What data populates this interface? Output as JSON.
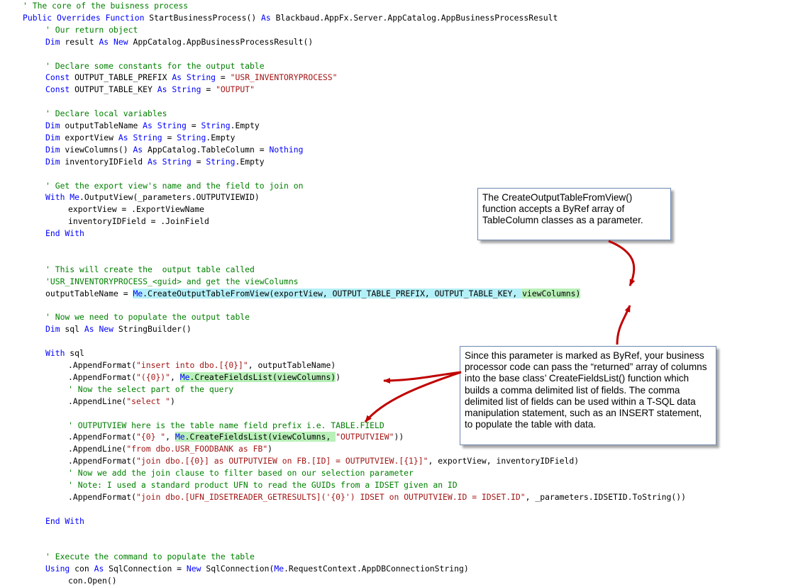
{
  "code_lines": [
    {
      "indent": 1,
      "segments": [
        {
          "t": "' The core of the buisness process",
          "c": "cmt"
        }
      ]
    },
    {
      "indent": 1,
      "segments": [
        {
          "t": "Public Overrides Function",
          "c": "kw"
        },
        {
          "t": " StartBusinessProcess() ",
          "c": "txt"
        },
        {
          "t": "As",
          "c": "kw"
        },
        {
          "t": " Blackbaud.AppFx.Server.AppCatalog.AppBusinessProcessResult",
          "c": "txt"
        }
      ]
    },
    {
      "indent": 2,
      "segments": [
        {
          "t": "' Our return object",
          "c": "cmt"
        }
      ]
    },
    {
      "indent": 2,
      "segments": [
        {
          "t": "Dim",
          "c": "kw"
        },
        {
          "t": " result ",
          "c": "txt"
        },
        {
          "t": "As New",
          "c": "kw"
        },
        {
          "t": " AppCatalog.AppBusinessProcessResult()",
          "c": "txt"
        }
      ]
    },
    {
      "indent": 0,
      "segments": []
    },
    {
      "indent": 2,
      "segments": [
        {
          "t": "' Declare some constants for the output table",
          "c": "cmt"
        }
      ]
    },
    {
      "indent": 2,
      "segments": [
        {
          "t": "Const",
          "c": "kw"
        },
        {
          "t": " OUTPUT_TABLE_PREFIX ",
          "c": "txt"
        },
        {
          "t": "As String",
          "c": "kw"
        },
        {
          "t": " = ",
          "c": "txt"
        },
        {
          "t": "\"USR_INVENTORYPROCESS\"",
          "c": "str"
        }
      ]
    },
    {
      "indent": 2,
      "segments": [
        {
          "t": "Const",
          "c": "kw"
        },
        {
          "t": " OUTPUT_TABLE_KEY ",
          "c": "txt"
        },
        {
          "t": "As String",
          "c": "kw"
        },
        {
          "t": " = ",
          "c": "txt"
        },
        {
          "t": "\"OUTPUT\"",
          "c": "str"
        }
      ]
    },
    {
      "indent": 0,
      "segments": []
    },
    {
      "indent": 2,
      "segments": [
        {
          "t": "' Declare local variables",
          "c": "cmt"
        }
      ]
    },
    {
      "indent": 2,
      "segments": [
        {
          "t": "Dim",
          "c": "kw"
        },
        {
          "t": " outputTableName ",
          "c": "txt"
        },
        {
          "t": "As String",
          "c": "kw"
        },
        {
          "t": " = ",
          "c": "txt"
        },
        {
          "t": "String",
          "c": "kw"
        },
        {
          "t": ".Empty",
          "c": "txt"
        }
      ]
    },
    {
      "indent": 2,
      "segments": [
        {
          "t": "Dim",
          "c": "kw"
        },
        {
          "t": " exportView ",
          "c": "txt"
        },
        {
          "t": "As String",
          "c": "kw"
        },
        {
          "t": " = ",
          "c": "txt"
        },
        {
          "t": "String",
          "c": "kw"
        },
        {
          "t": ".Empty",
          "c": "txt"
        }
      ]
    },
    {
      "indent": 2,
      "segments": [
        {
          "t": "Dim",
          "c": "kw"
        },
        {
          "t": " viewColumns() ",
          "c": "txt"
        },
        {
          "t": "As",
          "c": "kw"
        },
        {
          "t": " AppCatalog.TableColumn = ",
          "c": "txt"
        },
        {
          "t": "Nothing",
          "c": "kw"
        }
      ]
    },
    {
      "indent": 2,
      "segments": [
        {
          "t": "Dim",
          "c": "kw"
        },
        {
          "t": " inventoryIDField ",
          "c": "txt"
        },
        {
          "t": "As String",
          "c": "kw"
        },
        {
          "t": " = ",
          "c": "txt"
        },
        {
          "t": "String",
          "c": "kw"
        },
        {
          "t": ".Empty",
          "c": "txt"
        }
      ]
    },
    {
      "indent": 0,
      "segments": []
    },
    {
      "indent": 2,
      "segments": [
        {
          "t": "' Get the export view's name and the field to join on",
          "c": "cmt"
        }
      ]
    },
    {
      "indent": 2,
      "segments": [
        {
          "t": "With Me",
          "c": "kw"
        },
        {
          "t": ".OutputView(_parameters.OUTPUTVIEWID)",
          "c": "txt"
        }
      ]
    },
    {
      "indent": 3,
      "segments": [
        {
          "t": "exportView = .ExportViewName",
          "c": "txt"
        }
      ]
    },
    {
      "indent": 3,
      "segments": [
        {
          "t": "inventoryIDField = .JoinField",
          "c": "txt"
        }
      ]
    },
    {
      "indent": 2,
      "segments": [
        {
          "t": "End With",
          "c": "kw"
        }
      ]
    },
    {
      "indent": 0,
      "segments": []
    },
    {
      "indent": 0,
      "segments": []
    },
    {
      "indent": 2,
      "segments": [
        {
          "t": "' This will create the  output table called",
          "c": "cmt"
        }
      ]
    },
    {
      "indent": 2,
      "segments": [
        {
          "t": "'USR_INVENTORYPROCESS_<guid> and get the viewColumns",
          "c": "cmt"
        }
      ]
    },
    {
      "indent": 2,
      "segments": [
        {
          "t": "outputTableName = ",
          "c": "txt"
        },
        {
          "t": "Me",
          "c": "kw",
          "h": "blue"
        },
        {
          "t": ".CreateOutputTableFromView(exportView, OUTPUT_TABLE_PREFIX, OUTPUT_TABLE_KEY, ",
          "c": "txt",
          "h": "blue"
        },
        {
          "t": "viewColumns)",
          "c": "txt",
          "h": "green"
        }
      ]
    },
    {
      "indent": 0,
      "segments": []
    },
    {
      "indent": 2,
      "segments": [
        {
          "t": "' Now we need to populate the output table",
          "c": "cmt"
        }
      ]
    },
    {
      "indent": 2,
      "segments": [
        {
          "t": "Dim",
          "c": "kw"
        },
        {
          "t": " sql ",
          "c": "txt"
        },
        {
          "t": "As New",
          "c": "kw"
        },
        {
          "t": " StringBuilder()",
          "c": "txt"
        }
      ]
    },
    {
      "indent": 0,
      "segments": []
    },
    {
      "indent": 2,
      "segments": [
        {
          "t": "With",
          "c": "kw"
        },
        {
          "t": " sql",
          "c": "txt"
        }
      ]
    },
    {
      "indent": 3,
      "segments": [
        {
          "t": ".AppendFormat(",
          "c": "txt"
        },
        {
          "t": "\"insert into dbo.[{0}]\"",
          "c": "str"
        },
        {
          "t": ", outputTableName)",
          "c": "txt"
        }
      ]
    },
    {
      "indent": 3,
      "segments": [
        {
          "t": ".AppendFormat(",
          "c": "txt"
        },
        {
          "t": "\"({0})\"",
          "c": "str"
        },
        {
          "t": ", ",
          "c": "txt"
        },
        {
          "t": "Me",
          "c": "kw",
          "h": "green"
        },
        {
          "t": ".CreateFieldsList(viewColumns)",
          "c": "txt",
          "h": "green"
        },
        {
          "t": ")",
          "c": "txt"
        }
      ]
    },
    {
      "indent": 3,
      "segments": [
        {
          "t": "' Now the select part of the query",
          "c": "cmt"
        }
      ]
    },
    {
      "indent": 3,
      "segments": [
        {
          "t": ".AppendLine(",
          "c": "txt"
        },
        {
          "t": "\"select \"",
          "c": "str"
        },
        {
          "t": ")",
          "c": "txt"
        }
      ]
    },
    {
      "indent": 0,
      "segments": []
    },
    {
      "indent": 3,
      "segments": [
        {
          "t": "' OUTPUTVIEW here is the table name field prefix i.e. TABLE.FIELD",
          "c": "cmt"
        }
      ]
    },
    {
      "indent": 3,
      "segments": [
        {
          "t": ".AppendFormat(",
          "c": "txt"
        },
        {
          "t": "\"{0} \"",
          "c": "str"
        },
        {
          "t": ", ",
          "c": "txt"
        },
        {
          "t": "Me",
          "c": "kw",
          "h": "green"
        },
        {
          "t": ".CreateFieldsList(viewColumns, ",
          "c": "txt",
          "h": "green"
        },
        {
          "t": "\"OUTPUTVIEW\"",
          "c": "str"
        },
        {
          "t": "))",
          "c": "txt"
        }
      ]
    },
    {
      "indent": 3,
      "segments": [
        {
          "t": ".AppendLine(",
          "c": "txt"
        },
        {
          "t": "\"from dbo.USR_FOODBANK as FB\"",
          "c": "str"
        },
        {
          "t": ")",
          "c": "txt"
        }
      ]
    },
    {
      "indent": 3,
      "segments": [
        {
          "t": ".AppendFormat(",
          "c": "txt"
        },
        {
          "t": "\"join dbo.[{0}] as OUTPUTVIEW on FB.[ID] = OUTPUTVIEW.[{1}]\"",
          "c": "str"
        },
        {
          "t": ", exportView, inventoryIDField)",
          "c": "txt"
        }
      ]
    },
    {
      "indent": 3,
      "segments": [
        {
          "t": "' Now we add the join clause to filter based on our selection parameter",
          "c": "cmt"
        }
      ]
    },
    {
      "indent": 3,
      "segments": [
        {
          "t": "' Note: I used a standard product UFN to read the GUIDs from a IDSET given an ID",
          "c": "cmt"
        }
      ]
    },
    {
      "indent": 3,
      "segments": [
        {
          "t": ".AppendFormat(",
          "c": "txt"
        },
        {
          "t": "\"join dbo.[UFN_IDSETREADER_GETRESULTS]('{0}') IDSET on OUTPUTVIEW.ID = IDSET.ID\"",
          "c": "str"
        },
        {
          "t": ", _parameters.IDSETID.ToString())",
          "c": "txt"
        }
      ]
    },
    {
      "indent": 0,
      "segments": []
    },
    {
      "indent": 2,
      "segments": [
        {
          "t": "End With",
          "c": "kw"
        }
      ]
    },
    {
      "indent": 0,
      "segments": []
    },
    {
      "indent": 0,
      "segments": []
    },
    {
      "indent": 2,
      "segments": [
        {
          "t": "' Execute the command to populate the table",
          "c": "cmt"
        }
      ]
    },
    {
      "indent": 2,
      "segments": [
        {
          "t": "Using",
          "c": "kw"
        },
        {
          "t": " con ",
          "c": "txt"
        },
        {
          "t": "As",
          "c": "kw"
        },
        {
          "t": " SqlConnection = ",
          "c": "txt"
        },
        {
          "t": "New",
          "c": "kw"
        },
        {
          "t": " SqlConnection(",
          "c": "txt"
        },
        {
          "t": "Me",
          "c": "kw"
        },
        {
          "t": ".RequestContext.AppDBConnectionString)",
          "c": "txt"
        }
      ]
    },
    {
      "indent": 3,
      "segments": [
        {
          "t": "con.Open()",
          "c": "txt"
        }
      ]
    }
  ],
  "callouts": {
    "create_output": "The CreateOutputTableFromView() function accepts a ByRef array of TableColumn classes as a parameter.",
    "byref_explanation": "Since this parameter is marked as ByRef, your business processor code can pass the “returned” array of columns into the base class’ CreateFieldsList() function which builds a comma delimited list of fields.  The comma delimited list of fields can be used within a T-SQL data manipulation statement, such as an INSERT statement, to populate the table with data."
  },
  "colors": {
    "comment": "#008000",
    "keyword": "#0000ff",
    "string": "#a31515",
    "highlight_blue": "#b4f0f8",
    "highlight_green": "#b8f0b8",
    "arrow": "#c00000"
  }
}
